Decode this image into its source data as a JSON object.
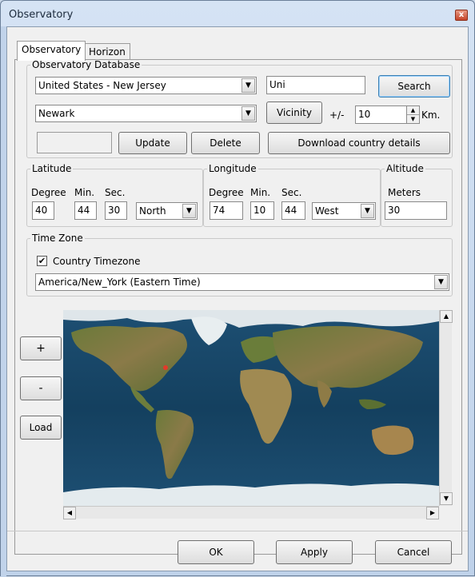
{
  "window": {
    "title": "Observatory",
    "close_glyph": "x"
  },
  "tabs": [
    {
      "label": "Observatory",
      "active": true
    },
    {
      "label": "Horizon",
      "active": false
    }
  ],
  "database": {
    "legend": "Observatory Database",
    "country": "United States - New Jersey",
    "search_text": "Uni",
    "search_label": "Search",
    "city": "Newark",
    "vicinity_label": "Vicinity",
    "plus_minus": "+/-",
    "radius": "10",
    "units": "Km.",
    "blank_value": "",
    "update_label": "Update",
    "delete_label": "Delete",
    "download_label": "Download country details"
  },
  "latitude": {
    "legend": "Latitude",
    "degree_label": "Degree",
    "min_label": "Min.",
    "sec_label": "Sec.",
    "degree": "40",
    "min": "44",
    "sec": "30",
    "hemisphere": "North"
  },
  "longitude": {
    "legend": "Longitude",
    "degree_label": "Degree",
    "min_label": "Min.",
    "sec_label": "Sec.",
    "degree": "74",
    "min": "10",
    "sec": "44",
    "hemisphere": "West"
  },
  "altitude": {
    "legend": "Altitude",
    "meters_label": "Meters",
    "value": "30"
  },
  "timezone": {
    "legend": "Time Zone",
    "country_tz_label": "Country Timezone",
    "country_tz_checked": true,
    "selected": "America/New_York (Eastern Time)"
  },
  "map": {
    "zoom_in_label": "+",
    "zoom_out_label": "-",
    "load_label": "Load",
    "ocean_color": "#1d4f73",
    "marker_color": "#e23a2a"
  },
  "footer": {
    "ok_label": "OK",
    "apply_label": "Apply",
    "cancel_label": "Cancel"
  }
}
